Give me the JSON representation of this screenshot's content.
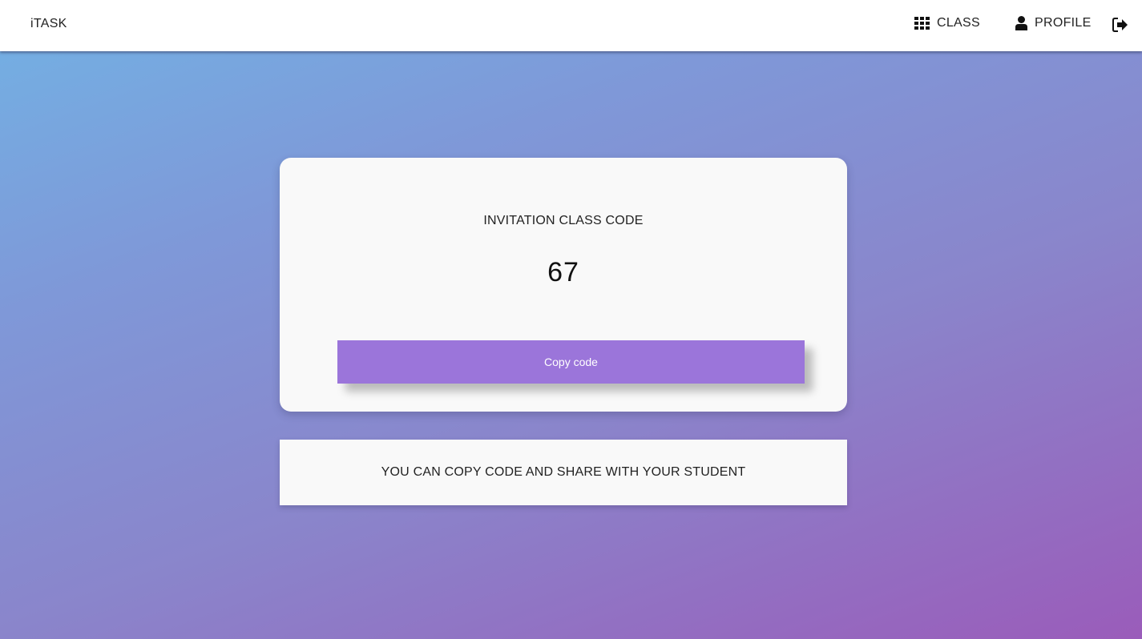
{
  "navbar": {
    "brand": "iTASK",
    "items": [
      {
        "label": "CLASS",
        "icon": "grid-icon"
      },
      {
        "label": "PROFILE",
        "icon": "user-icon"
      }
    ],
    "logout_icon": "sign-out-icon"
  },
  "card": {
    "title": "INVITATION CLASS CODE",
    "code": "67",
    "button_label": "Copy code"
  },
  "note": {
    "text": "YOU CAN COPY CODE AND SHARE WITH YOUR STUDENT"
  },
  "colors": {
    "button": "#9b75da",
    "card_bg": "#f9f9f9",
    "gradient_start": "#72b2e4",
    "gradient_end": "#9a5cba"
  }
}
